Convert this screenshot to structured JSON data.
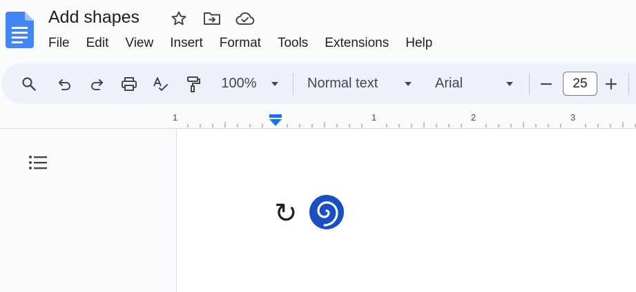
{
  "document": {
    "title": "Add shapes"
  },
  "menu": [
    "File",
    "Edit",
    "View",
    "Insert",
    "Format",
    "Tools",
    "Extensions",
    "Help"
  ],
  "toolbar": {
    "zoom": "100%",
    "style": "Normal text",
    "font": "Arial",
    "font_size": "25"
  },
  "ruler": {
    "labels": [
      "1",
      "1",
      "2",
      "3"
    ]
  },
  "content": {
    "arrow_symbol": "↻"
  },
  "colors": {
    "accent": "#1a73e8",
    "shape_blue": "#1a4fc4",
    "toolbar_bg": "#edf2fa"
  },
  "icons": [
    "docs-logo",
    "star-icon",
    "move-folder-icon",
    "cloud-check-icon",
    "search-icon",
    "undo-icon",
    "redo-icon",
    "print-icon",
    "spellcheck-icon",
    "paint-format-icon",
    "dropdown-icon",
    "minus-icon",
    "plus-icon",
    "outline-icon",
    "spiral-shape"
  ]
}
